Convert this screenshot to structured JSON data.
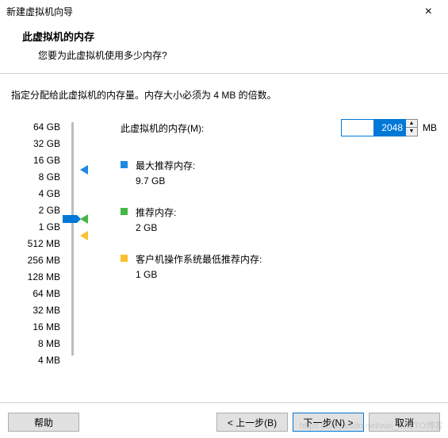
{
  "titlebar": {
    "title": "新建虚拟机向导"
  },
  "header": {
    "h1": "此虚拟机的内存",
    "h2": "您要为此虚拟机使用多少内存?"
  },
  "instruction": "指定分配给此虚拟机的内存量。内存大小必须为 4 MB 的倍数。",
  "memory": {
    "label": "此虚拟机的内存(M):",
    "value": "2048",
    "unit": "MB"
  },
  "scale": [
    "64 GB",
    "32 GB",
    "16 GB",
    "8 GB",
    "4 GB",
    "2 GB",
    "1 GB",
    "512 MB",
    "256 MB",
    "128 MB",
    "64 MB",
    "32 MB",
    "16 MB",
    "8 MB",
    "4 MB"
  ],
  "info": {
    "max": {
      "label": "最大推荐内存:",
      "value": "9.7 GB"
    },
    "rec": {
      "label": "推荐内存:",
      "value": "2 GB"
    },
    "guest": {
      "label": "客户机操作系统最低推荐内存:",
      "value": "1 GB"
    }
  },
  "buttons": {
    "help": "帮助",
    "back": "< 上一步(B)",
    "next": "下一步(N) >",
    "cancel": "取消"
  },
  "watermark": "https://blog.csdn.net/wei_51CTO博客"
}
